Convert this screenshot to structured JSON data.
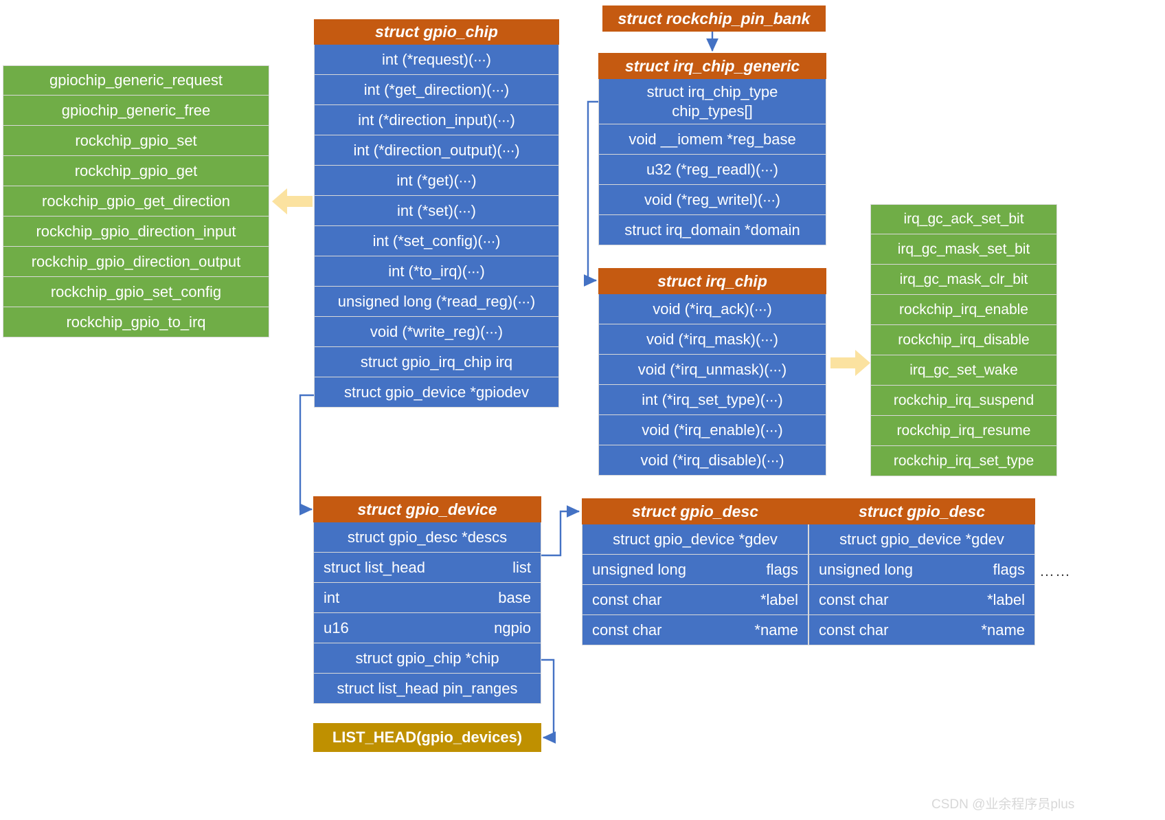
{
  "colors": {
    "header_orange": "#C55A11",
    "row_blue": "#4472C4",
    "green": "#70AD47",
    "gold": "#BF9000",
    "arrow_blue": "#4472C4",
    "block_arrow_yellow": "#FBE2A0",
    "block_arrow_border": "#FBE2A0"
  },
  "gpio_ops_list": {
    "items": [
      "gpiochip_generic_request",
      "gpiochip_generic_free",
      "rockchip_gpio_set",
      "rockchip_gpio_get",
      "rockchip_gpio_get_direction",
      "rockchip_gpio_direction_input",
      "rockchip_gpio_direction_output",
      "rockchip_gpio_set_config",
      "rockchip_gpio_to_irq"
    ]
  },
  "gpio_chip": {
    "title": "struct gpio_chip",
    "rows": [
      "int (*request)(∙∙∙)",
      "int (*get_direction)(∙∙∙)",
      "int (*direction_input)(∙∙∙)",
      "int (*direction_output)(∙∙∙)",
      "int (*get)(∙∙∙)",
      "int (*set)(∙∙∙)",
      "int (*set_config)(∙∙∙)",
      "int (*to_irq)(∙∙∙)",
      "unsigned long (*read_reg)(∙∙∙)",
      "void (*write_reg)(∙∙∙)",
      "struct gpio_irq_chip irq",
      "struct gpio_device *gpiodev"
    ]
  },
  "rockchip_pin_bank": {
    "title": "struct rockchip_pin_bank"
  },
  "irq_chip_generic": {
    "title": "struct irq_chip_generic",
    "rows": [
      "struct irq_chip_type\nchip_types[]",
      "void __iomem *reg_base",
      "u32    (*reg_readl)(∙∙∙)",
      "void   (*reg_writel)(∙∙∙)",
      "struct irq_domain *domain"
    ]
  },
  "irq_chip": {
    "title": "struct irq_chip",
    "rows": [
      "void   (*irq_ack)(∙∙∙)",
      "void   (*irq_mask)(∙∙∙)",
      "void   (*irq_unmask)(∙∙∙)",
      "int      (*irq_set_type)(∙∙∙)",
      "void   (*irq_enable)(∙∙∙)",
      "void   (*irq_disable)(∙∙∙)"
    ]
  },
  "irq_ops_list": {
    "items": [
      "irq_gc_ack_set_bit",
      "irq_gc_mask_set_bit",
      "irq_gc_mask_clr_bit",
      "rockchip_irq_enable",
      "rockchip_irq_disable",
      "irq_gc_set_wake",
      "rockchip_irq_suspend",
      "rockchip_irq_resume",
      "rockchip_irq_set_type"
    ]
  },
  "gpio_device": {
    "title": "struct gpio_device",
    "rows": [
      {
        "type": "struct gpio_desc  *descs",
        "name": ""
      },
      {
        "type": "struct list_head",
        "name": "list"
      },
      {
        "type": "int",
        "name": "base"
      },
      {
        "type": "u16",
        "name": "ngpio"
      },
      {
        "type": "struct gpio_chip  *chip",
        "name": ""
      },
      {
        "type": "struct list_head pin_ranges",
        "name": ""
      }
    ]
  },
  "gpio_desc_1": {
    "title": "struct gpio_desc",
    "rows": [
      {
        "type": "struct gpio_device *gdev",
        "name": ""
      },
      {
        "type": "unsigned long",
        "name": "flags"
      },
      {
        "type": "const char",
        "name": "*label"
      },
      {
        "type": "const char",
        "name": "*name"
      }
    ]
  },
  "gpio_desc_2": {
    "title": "struct gpio_desc",
    "rows": [
      {
        "type": "struct gpio_device *gdev",
        "name": ""
      },
      {
        "type": "unsigned long",
        "name": "flags"
      },
      {
        "type": "const char",
        "name": "*label"
      },
      {
        "type": "const char",
        "name": "*name"
      }
    ]
  },
  "desc_ellipsis": "……",
  "list_head": {
    "label": "LIST_HEAD(gpio_devices)"
  },
  "watermark": {
    "text": "CSDN @业余程序员plus"
  }
}
